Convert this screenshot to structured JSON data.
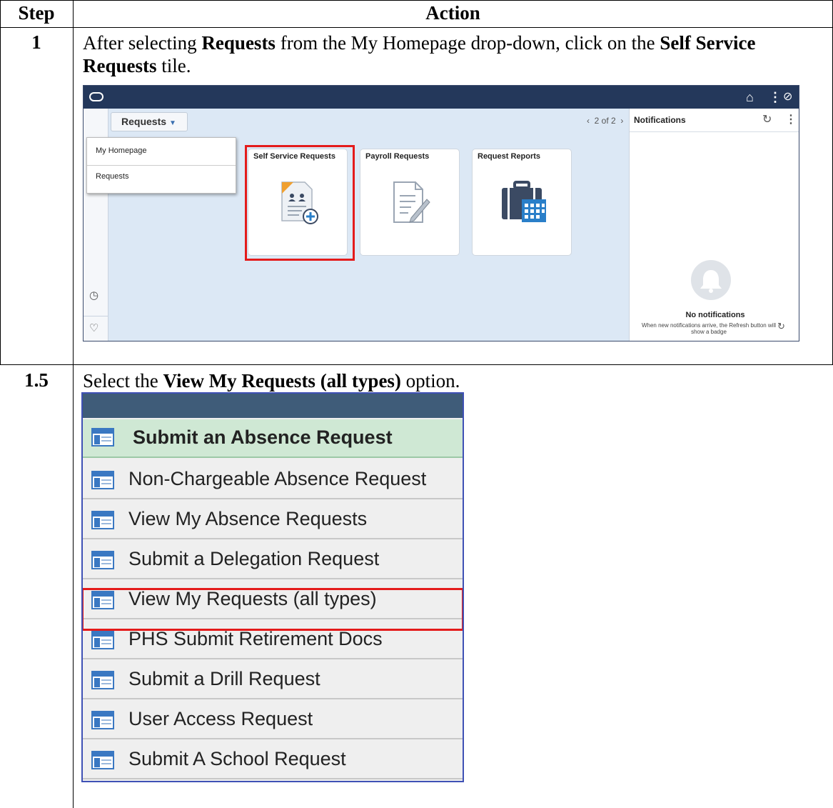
{
  "table": {
    "header": {
      "step": "Step",
      "action": "Action"
    },
    "rows": [
      {
        "step": "1",
        "instruction_pre": "After selecting ",
        "bold1": "Requests",
        "instruction_mid": " from the My Homepage drop-down, click on the ",
        "bold2": "Self Service Requests",
        "instruction_post": " tile."
      },
      {
        "step": "1.5",
        "instruction_pre": "Select the ",
        "bold1": "View My Requests (all types)",
        "instruction_post": " option."
      }
    ]
  },
  "screenshot1": {
    "requests_button": "Requests",
    "dropdown_items": [
      "My Homepage",
      "Requests"
    ],
    "pager": "2 of 2",
    "tiles": [
      "Self Service Requests",
      "Payroll Requests",
      "Request Reports"
    ],
    "notifications": {
      "title": "Notifications",
      "empty_title": "No notifications",
      "empty_desc": "When new notifications arrive, the Refresh button will show a badge"
    },
    "icons": [
      "oracle-logo-icon",
      "home-icon",
      "kebab-menu-icon",
      "compass-icon",
      "clock-icon",
      "heart-icon",
      "refresh-icon",
      "bell-icon"
    ],
    "colors": {
      "topbar": "#24385b",
      "highlight": "#e41b1b",
      "background": "#dce8f5"
    }
  },
  "screenshot2": {
    "items": [
      "Submit an Absence Request",
      "Non-Chargeable Absence Request",
      "View My Absence Requests",
      "Submit a Delegation Request",
      "View My Requests (all types)",
      "PHS Submit Retirement Docs",
      "Submit a Drill Request",
      "User Access Request",
      "Submit A School Request"
    ],
    "highlighted_item": "View My Requests (all types)",
    "colors": {
      "header_bar": "#3f5c79",
      "selected_row": "#cfe8d4",
      "highlight": "#e41b1b"
    }
  }
}
